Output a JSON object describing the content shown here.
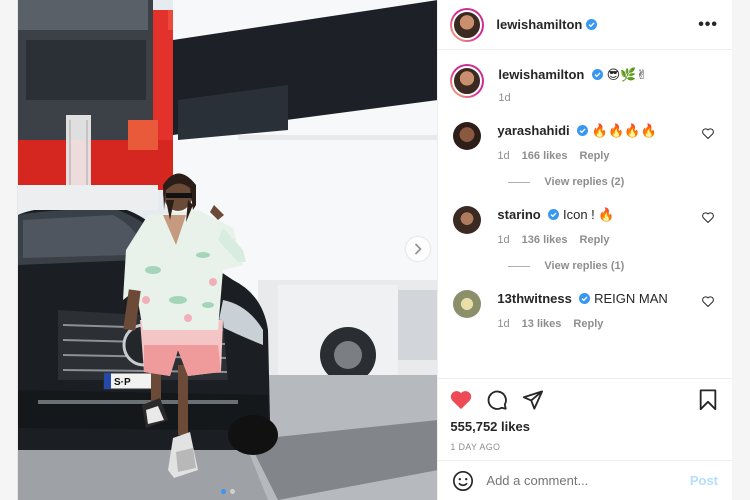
{
  "post": {
    "owner": "lewishamilton",
    "more_label": "•••"
  },
  "caption": {
    "username": "lewishamilton",
    "text": "😎🌿✌",
    "time": "1d"
  },
  "comments": [
    {
      "username": "yarashahidi",
      "verified": true,
      "text": "🔥🔥🔥🔥",
      "time": "1d",
      "likes": "166 likes",
      "reply": "Reply",
      "view_replies": "View replies (2)"
    },
    {
      "username": "starino",
      "verified": true,
      "text": "Icon ! 🔥",
      "time": "1d",
      "likes": "136 likes",
      "reply": "Reply",
      "view_replies": "View replies (1)"
    },
    {
      "username": "13thwitness",
      "verified": true,
      "text": "REIGN MAN",
      "time": "1d",
      "likes": "13 likes",
      "reply": "Reply",
      "view_replies": ""
    }
  ],
  "engagement": {
    "likes": "555,752 likes",
    "time_ago": "1 DAY AGO"
  },
  "composer": {
    "placeholder": "Add a comment...",
    "post_label": "Post"
  },
  "colors": {
    "heart_active": "#ed4956",
    "verified": "#3897f0",
    "post_disabled": "#b2dffc"
  },
  "carousel": {
    "slide_count": 2,
    "active_index": 0
  }
}
